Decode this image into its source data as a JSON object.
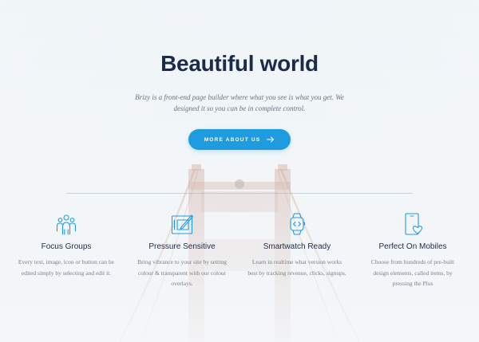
{
  "hero": {
    "title": "Beautiful world",
    "subtitle": "Brizy is a front-end page builder where what you see is what you get. We designed it so you can be in complete control.",
    "cta_label": "MORE ABOUT US",
    "cta_icon": "arrow-right-icon"
  },
  "colors": {
    "accent": "#1f9ce0",
    "heading": "#1c2b4a",
    "body_text": "#7a808a",
    "background": "#f0f5f8"
  },
  "features": [
    {
      "icon": "users-group-icon",
      "title": "Focus Groups",
      "text": "Every text, image, icon or button can be edited simply by selecting and edit it."
    },
    {
      "icon": "pen-tablet-icon",
      "title": "Pressure Sensitive",
      "text": "Bring vibrance to your site by setting colour & transparent with our colour overlays."
    },
    {
      "icon": "smartwatch-icon",
      "title": "Smartwatch Ready",
      "text": "Learn in realtime what version works best by tracking revenue, clicks, signups."
    },
    {
      "icon": "mobile-heart-icon",
      "title": "Perfect On Mobiles",
      "text": "Choose from hundreds of pre-built design elements, called items, by pressing the Plus"
    }
  ]
}
